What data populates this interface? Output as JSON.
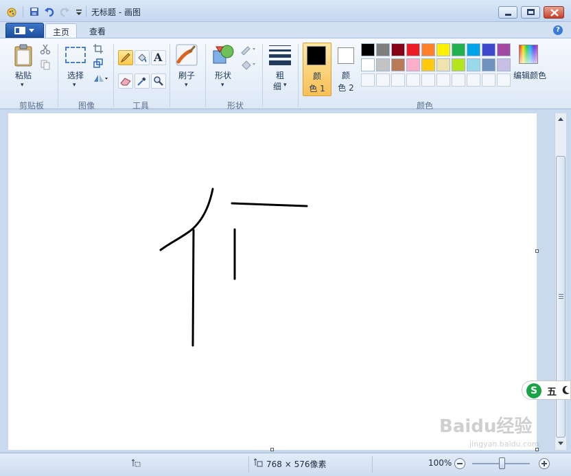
{
  "window": {
    "title": "无标题 - 画图"
  },
  "tabs": [
    {
      "label": "主页"
    },
    {
      "label": "查看"
    }
  ],
  "ribbon": {
    "clipboard": {
      "paste": "粘贴",
      "group": "剪贴板"
    },
    "image": {
      "select": "选择",
      "group": "图像"
    },
    "tools": {
      "group": "工具"
    },
    "brushes": {
      "label": "刷子"
    },
    "shapes": {
      "label": "形状",
      "group": "形状"
    },
    "size": {
      "label_line1": "粗",
      "label_line2": "细"
    },
    "colors": {
      "color1_line1": "颜",
      "color1_line2": "色 1",
      "color2_line1": "颜",
      "color2_line2": "色 2",
      "edit": "编辑颜色",
      "group": "颜色",
      "color1_value": "#000000",
      "color2_value": "#ffffff",
      "palette_row1": [
        "#000000",
        "#7f7f7f",
        "#880015",
        "#ed1c24",
        "#ff7f27",
        "#fff200",
        "#22b14c",
        "#00a2e8",
        "#3f48cc",
        "#a349a4"
      ],
      "palette_row2": [
        "#ffffff",
        "#c3c3c3",
        "#b97a57",
        "#ffaec9",
        "#ffc90e",
        "#efe4b0",
        "#b5e61d",
        "#99d9ea",
        "#7092be",
        "#c8bfe7"
      ]
    }
  },
  "status": {
    "dimensions": "768 × 576像素",
    "zoom": "100%"
  },
  "ime": {
    "label": "五"
  },
  "watermark": {
    "main": "Baidu经验",
    "sub": "jingyan.baidu.com"
  }
}
